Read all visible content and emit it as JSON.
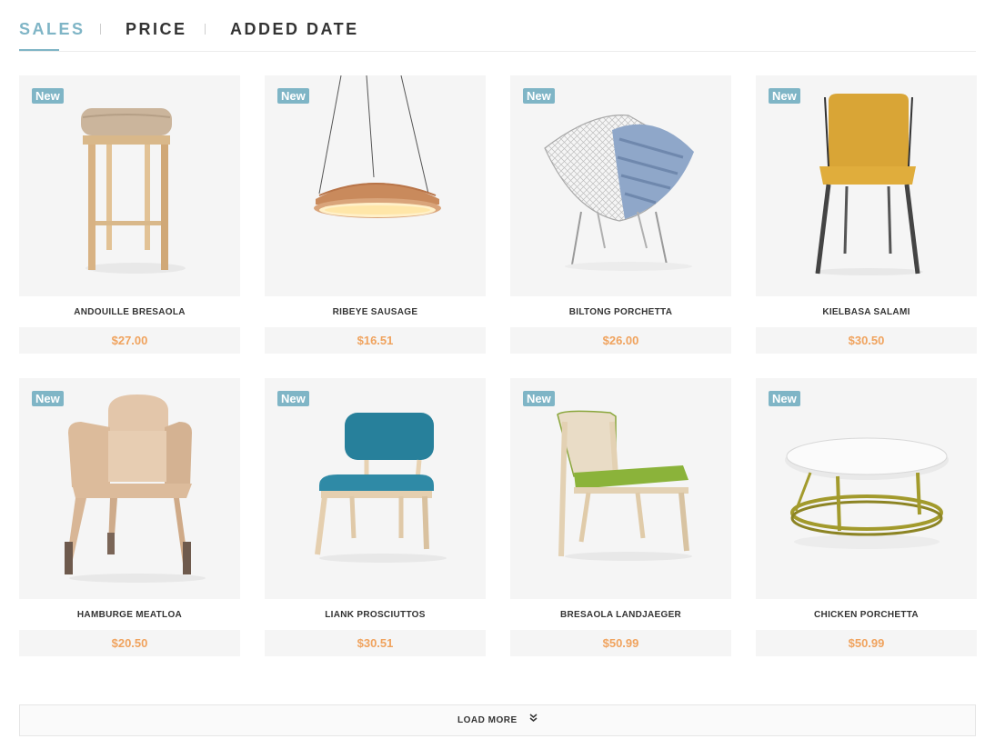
{
  "sort_tabs": [
    {
      "label": "SALES",
      "active": true
    },
    {
      "label": "PRICE",
      "active": false
    },
    {
      "label": "ADDED DATE",
      "active": false
    }
  ],
  "accent_color": "#7fb5c6",
  "price_color": "#f0a35e",
  "products": [
    {
      "badge": "New",
      "name": "ANDOUILLE BRESAOLA",
      "price": "$27.00",
      "image": "bar-stool-icon"
    },
    {
      "badge": "New",
      "name": "RIBEYE SAUSAGE",
      "price": "$16.51",
      "image": "pendant-lamp-icon"
    },
    {
      "badge": "New",
      "name": "BILTONG PORCHETTA",
      "price": "$26.00",
      "image": "wire-chair-icon"
    },
    {
      "badge": "New",
      "name": "KIELBASA SALAMI",
      "price": "$30.50",
      "image": "mustard-chair-icon"
    },
    {
      "badge": "New",
      "name": "HAMBURGE MEATLOA",
      "price": "$20.50",
      "image": "armchair-icon"
    },
    {
      "badge": "New",
      "name": "LIANK PROSCIUTTOS",
      "price": "$30.51",
      "image": "teal-chair-icon"
    },
    {
      "badge": "New",
      "name": "BRESAOLA LANDJAEGER",
      "price": "$50.99",
      "image": "green-chair-icon"
    },
    {
      "badge": "New",
      "name": "CHICKEN PORCHETTA",
      "price": "$50.99",
      "image": "round-table-icon"
    }
  ],
  "load_more": {
    "label": "LOAD MORE",
    "icon": "double-chevron-down-icon"
  }
}
